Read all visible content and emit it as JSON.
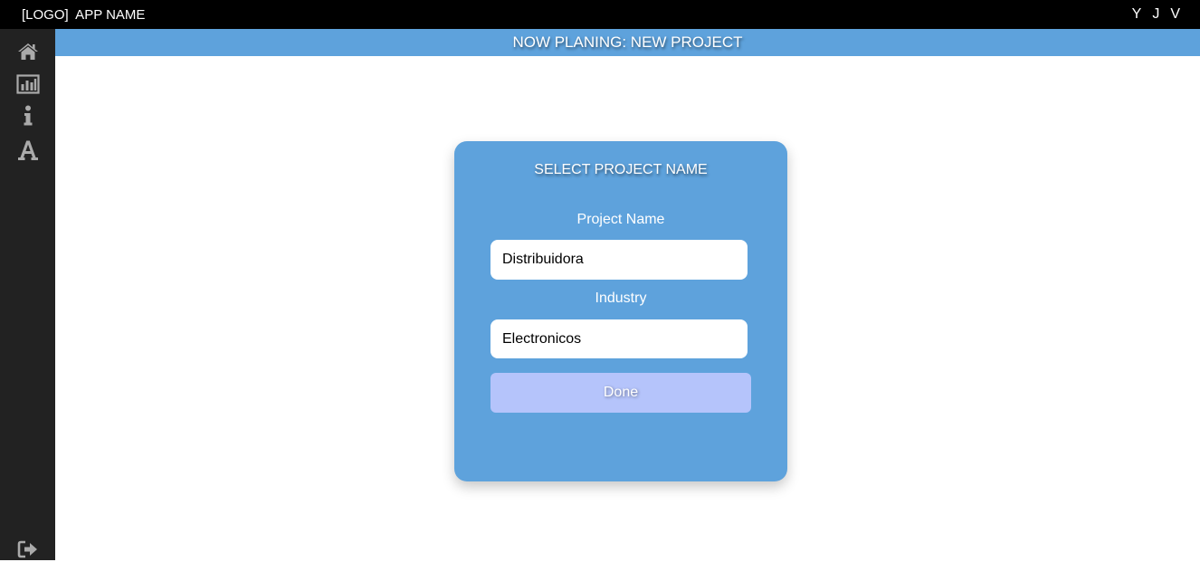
{
  "header": {
    "brand": "[LOGO]  APP NAME",
    "user_initials": [
      "Y",
      "J",
      "V"
    ]
  },
  "sidebar": {
    "items": [
      {
        "icon": "home-icon"
      },
      {
        "icon": "bar-chart-icon"
      },
      {
        "icon": "info-icon"
      },
      {
        "icon": "font-icon"
      }
    ],
    "footer_icon": "sign-out-icon"
  },
  "banner": {
    "text": "NOW PLANING: NEW PROJECT"
  },
  "form": {
    "title": "SELECT PROJECT NAME",
    "project_name_label": "Project Name",
    "project_name_value": "Distribuidora",
    "industry_label": "Industry",
    "industry_value": "Electronicos",
    "done_label": "Done"
  },
  "colors": {
    "topbar": "#000000",
    "sidebar": "#222222",
    "accent": "#5ea2dc",
    "button": "#b5c4fb",
    "icon": "#aaaaaa"
  }
}
